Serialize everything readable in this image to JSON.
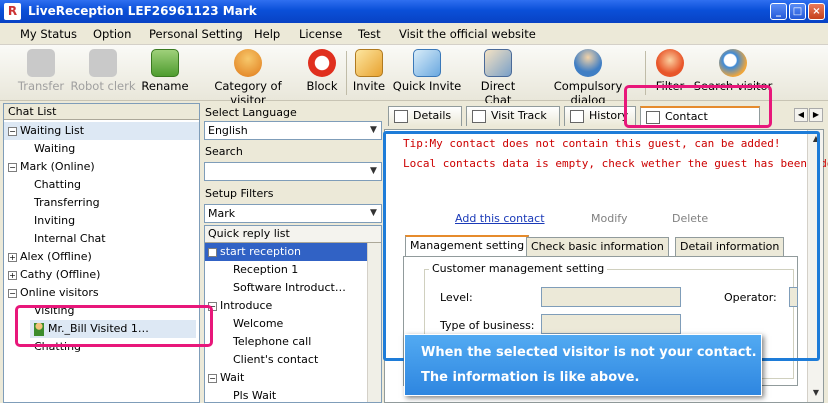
{
  "window": {
    "title": "LiveReception   LEF26961123 Mark"
  },
  "menu": [
    "My Status",
    "Option",
    "Personal Setting",
    "Help",
    "License",
    "Test",
    "Visit the official website"
  ],
  "toolbar": [
    {
      "label": "Transfer",
      "enabled": false,
      "icon": "transfer-icon"
    },
    {
      "label": "Robot clerk",
      "enabled": false,
      "icon": "robot-icon"
    },
    {
      "label": "Rename",
      "enabled": true,
      "icon": "rename-icon"
    },
    {
      "label": "Category of visitor",
      "enabled": true,
      "icon": "category-icon"
    },
    {
      "label": "Block",
      "enabled": true,
      "icon": "block-icon"
    },
    {
      "label": "Invite",
      "enabled": true,
      "icon": "invite-icon"
    },
    {
      "label": "Quick Invite",
      "enabled": true,
      "icon": "quick-invite-icon"
    },
    {
      "label": "Direct Chat",
      "enabled": true,
      "icon": "direct-chat-icon"
    },
    {
      "label": "Compulsory dialog",
      "enabled": true,
      "icon": "compulsory-dialog-icon"
    },
    {
      "label": "Filter",
      "enabled": true,
      "icon": "filter-icon"
    },
    {
      "label": "Search visitor",
      "enabled": true,
      "icon": "search-visitor-icon"
    }
  ],
  "left_panel": {
    "header": "Chat List",
    "items": [
      {
        "label": "Waiting List",
        "toggle": "⊟"
      },
      {
        "label": "Waiting"
      },
      {
        "label": "Mark (Online)",
        "toggle": "⊟"
      },
      {
        "label": "Chatting"
      },
      {
        "label": "Transferring"
      },
      {
        "label": "Inviting"
      },
      {
        "label": "Internal Chat"
      },
      {
        "label": "Alex (Offline)",
        "toggle": "⊞"
      },
      {
        "label": "Cathy (Offline)",
        "toggle": "⊞"
      },
      {
        "label": "Online visitors",
        "toggle": "⊟"
      },
      {
        "label": "Visiting"
      },
      {
        "label": "Mr._Bill Visited 1…"
      },
      {
        "label": "Chatting"
      }
    ]
  },
  "mid_panel": {
    "language_label": "Select Language",
    "language_value": "English",
    "search_label": "Search",
    "search_value": "",
    "filters_label": "Setup Filters",
    "filters_value": "Mark",
    "quick_reply_header": "Quick reply list",
    "quick_reply": [
      {
        "label": "start reception",
        "toggle": "⊟"
      },
      {
        "label": "Reception 1"
      },
      {
        "label": "Software Introduct…"
      },
      {
        "label": "Introduce",
        "toggle": "⊟"
      },
      {
        "label": "Welcome"
      },
      {
        "label": "Telephone call"
      },
      {
        "label": "Client's contact"
      },
      {
        "label": "Wait",
        "toggle": "⊟"
      },
      {
        "label": "Pls Wait"
      }
    ]
  },
  "tabs": [
    "Details",
    "Visit Track",
    "History",
    "Contact Manager"
  ],
  "active_tab": "Contact Manager",
  "contact": {
    "tip1": "Tip:My contact does not contain this guest, can be added!",
    "tip2": "Local contacts data is empty, check wether the guest has been added",
    "add": "Add this contact",
    "modify": "Modify",
    "delete": "Delete",
    "subtabs": [
      "Management setting",
      "Check basic information",
      "Detail information"
    ],
    "group": "Customer management setting",
    "level_label": "Level:",
    "operator_label": "Operator:",
    "business_label": "Type of business:"
  },
  "callout": {
    "line1": "When the selected visitor is not your contact.",
    "line2": "The information is like above."
  },
  "colors": {
    "titlebar": "#0a4fd8",
    "highlight": "#e8177a",
    "frame": "#1e7cd8",
    "callout": "#3b94e8",
    "tip_red": "#cc0000",
    "selection": "#3162c5"
  }
}
